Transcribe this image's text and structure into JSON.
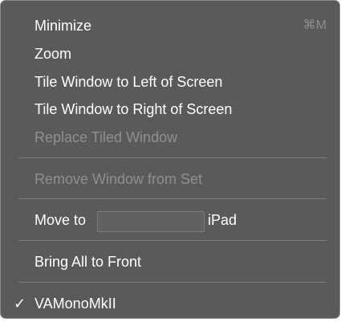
{
  "menu": {
    "minimize": {
      "label": "Minimize",
      "shortcut": "⌘M"
    },
    "zoom": {
      "label": "Zoom"
    },
    "tile_left": {
      "label": "Tile Window to Left of Screen"
    },
    "tile_right": {
      "label": "Tile Window to Right of Screen"
    },
    "replace_tiled": {
      "label": "Replace Tiled Window",
      "enabled": false
    },
    "remove_from_set": {
      "label": "Remove Window from Set",
      "enabled": false
    },
    "move_to": {
      "label": "Move to",
      "value": "",
      "suffix": "iPad"
    },
    "bring_all_front": {
      "label": "Bring All to Front"
    },
    "window_item": {
      "label": "VAMonoMkII",
      "checked": true,
      "checkmark": "✓"
    }
  },
  "colors": {
    "menu_background": "#5a5a5a",
    "enabled_text": "#ffffff",
    "disabled_text": "#8f8f8f",
    "separator": "#7c7c7c"
  }
}
